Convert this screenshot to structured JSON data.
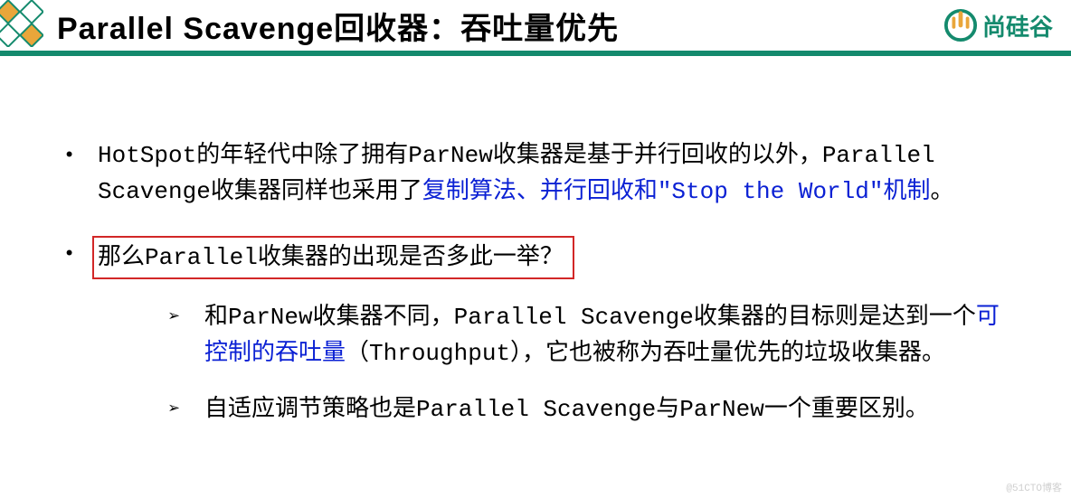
{
  "header": {
    "title": "Parallel Scavenge回收器：吞吐量优先",
    "brand": "尚硅谷"
  },
  "bullets": [
    {
      "pre": "HotSpot的年轻代中除了拥有ParNew收集器是基于并行回收的以外，Parallel Scavenge收集器同样也采用了",
      "blue": "复制算法、并行回收和\"Stop the World\"机制",
      "post": "。"
    },
    {
      "boxed": "那么Parallel收集器的出现是否多此一举？",
      "subs": [
        {
          "pre": "和ParNew收集器不同，Parallel Scavenge收集器的目标则是达到一个",
          "blue": "可控制的吞吐量",
          "post": "（Throughput），它也被称为吞吐量优先的垃圾收集器。"
        },
        {
          "text": "自适应调节策略也是Parallel Scavenge与ParNew一个重要区别。"
        }
      ]
    }
  ],
  "watermark": "@51CTO博客"
}
